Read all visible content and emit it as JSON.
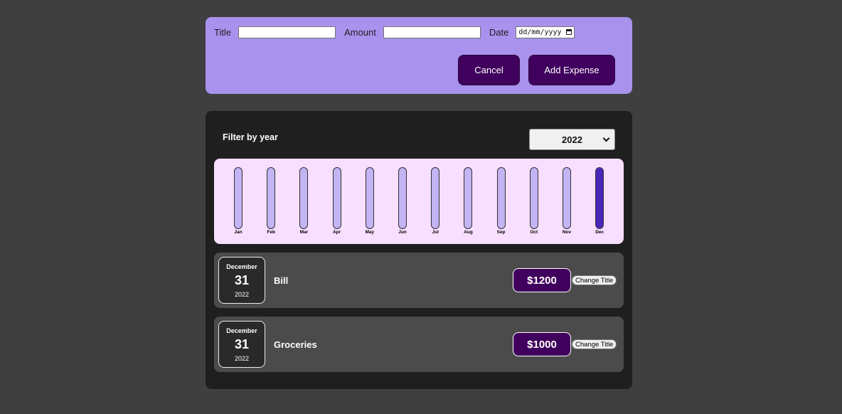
{
  "form": {
    "title_label": "Title",
    "title_value": "",
    "amount_label": "Amount",
    "amount_value": "",
    "date_label": "Date",
    "date_placeholder": "dd/mm/yyyy",
    "cancel_label": "Cancel",
    "add_label": "Add Expense"
  },
  "filter": {
    "label": "Filter by year",
    "selected_year": "2022"
  },
  "chart_data": {
    "type": "bar",
    "categories": [
      "Jan",
      "Feb",
      "Mar",
      "Apr",
      "May",
      "Jun",
      "Jul",
      "Aug",
      "Sep",
      "Oct",
      "Nov",
      "Dec"
    ],
    "values": [
      0,
      0,
      0,
      0,
      0,
      0,
      0,
      0,
      0,
      0,
      0,
      2200
    ],
    "max": 2200
  },
  "expenses": [
    {
      "month": "December",
      "day": "31",
      "year": "2022",
      "title": "Bill",
      "amount": "$1200",
      "change_label": "Change Title"
    },
    {
      "month": "December",
      "day": "31",
      "year": "2022",
      "title": "Groceries",
      "amount": "$1000",
      "change_label": "Change Title"
    }
  ],
  "colors": {
    "accent": "#40005d",
    "form_bg": "#a892ed",
    "chart_bg": "#f8dfff",
    "bar_fill": "#4826b9",
    "bar_track": "#c3b4f3"
  }
}
